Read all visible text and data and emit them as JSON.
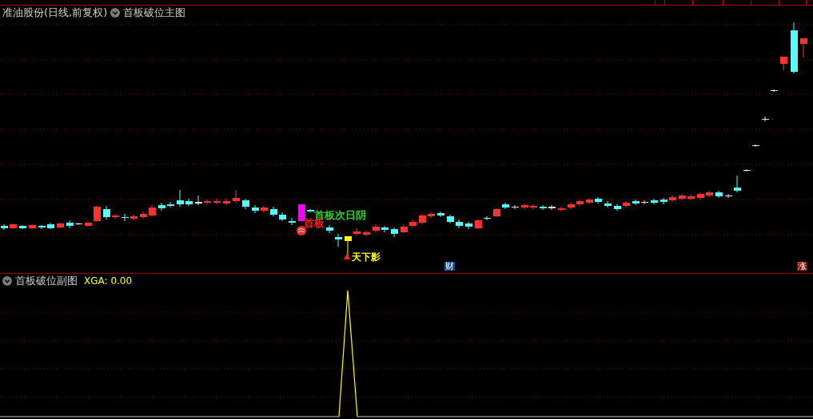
{
  "main_panel": {
    "stock_title": "准油股份(日线,前复权)",
    "indicator": "首板破位主图",
    "annotations": [
      {
        "text": "首板次日阴",
        "color": "#33cc33"
      },
      {
        "text": "首板",
        "color": "#ff2020"
      },
      {
        "text": "天下影",
        "color": "#ffff00"
      }
    ],
    "markers": [
      {
        "text": "财",
        "color": "#1a4f8a"
      },
      {
        "text": "涨",
        "color": "#8b0a0a"
      }
    ]
  },
  "sub_panel": {
    "indicator": "首板破位副图",
    "reading": "XGA: 0.00"
  }
}
